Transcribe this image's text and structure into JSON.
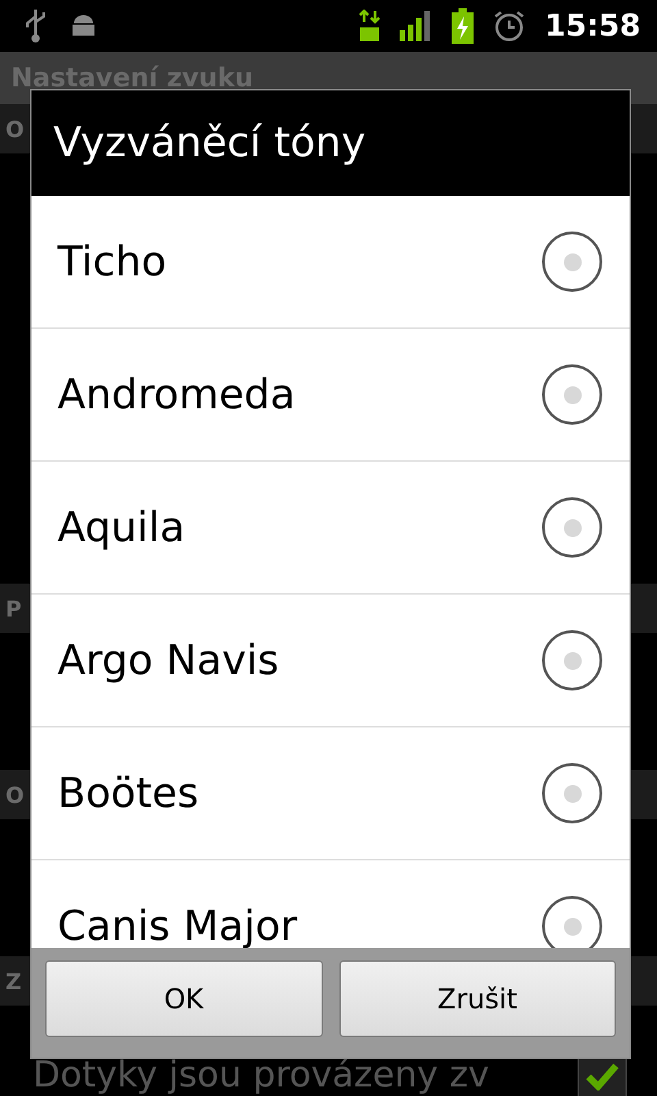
{
  "status_bar": {
    "time": "15:58"
  },
  "screen": {
    "title": "Nastavení zvuku",
    "sections": [
      {
        "header": "O"
      },
      {
        "header": "P"
      },
      {
        "header": "O"
      },
      {
        "header": "Z"
      }
    ],
    "bottom_item": {
      "label": "Dotyky jsou provázeny zv",
      "checked": true
    }
  },
  "dialog": {
    "title": "Vyzváněcí tóny",
    "items": [
      {
        "label": "Ticho",
        "selected": false
      },
      {
        "label": "Andromeda",
        "selected": false
      },
      {
        "label": "Aquila",
        "selected": false
      },
      {
        "label": "Argo Navis",
        "selected": false
      },
      {
        "label": "Boötes",
        "selected": false
      },
      {
        "label": "Canis Major",
        "selected": false
      }
    ],
    "buttons": [
      "OK",
      "Zrušit"
    ]
  }
}
